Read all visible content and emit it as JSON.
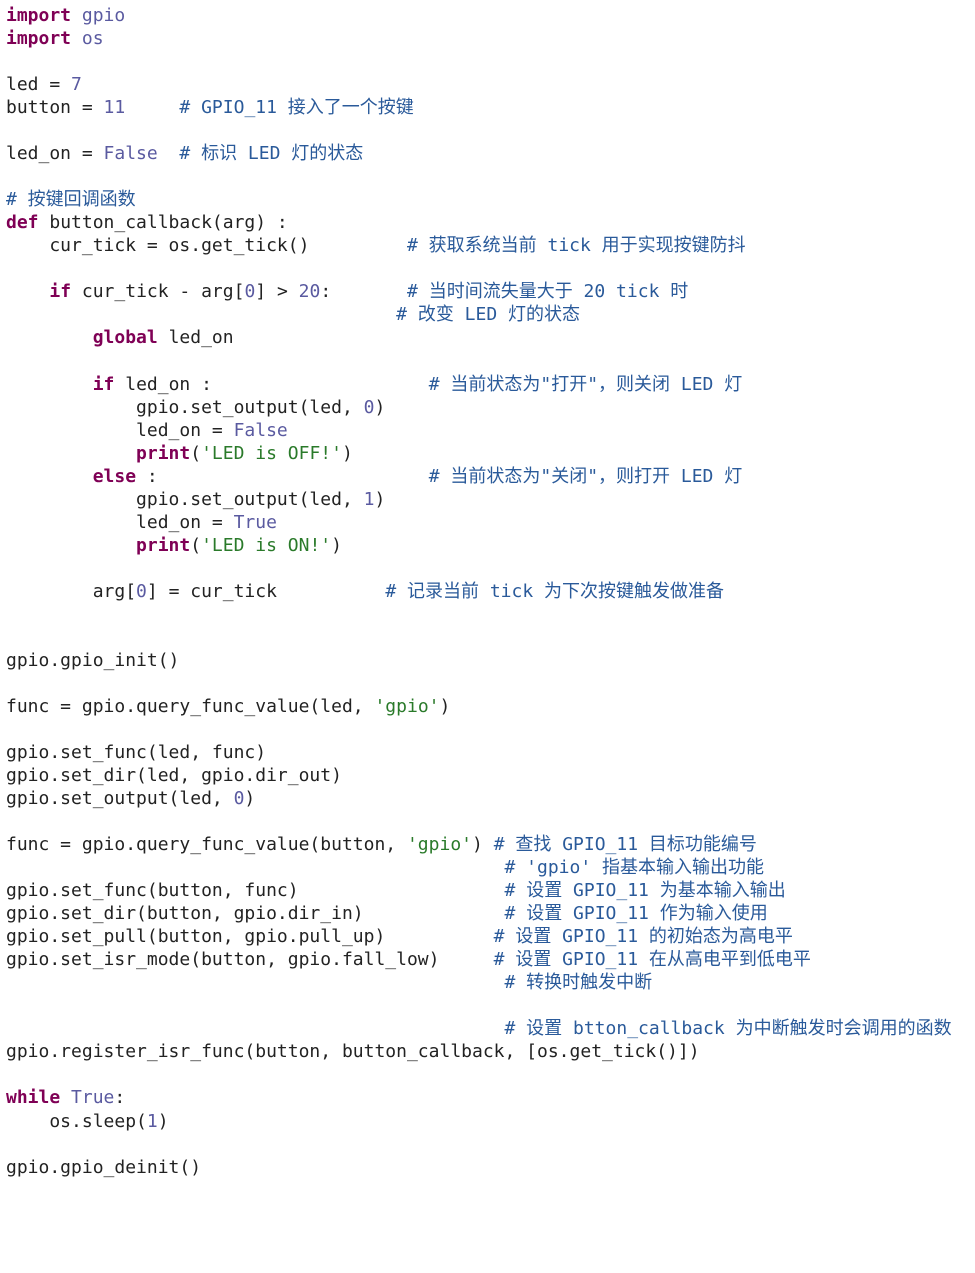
{
  "lines": {
    "l1_kw1": "import",
    "l1_mod": "gpio",
    "l2_kw1": "import",
    "l2_mod": "os",
    "l4_a": "led = ",
    "l4_num": "7",
    "l5_a": "button = ",
    "l5_num": "11",
    "l5_cmt": "# GPIO_11 接入了一个按键",
    "l7_a": "led_on = ",
    "l7_bool": "False",
    "l7_cmt": "# 标识 LED 灯的状态",
    "l9_cmt": "# 按键回调函数",
    "l10_def": "def",
    "l10_name": " button_callback(arg) :",
    "l11_a": "    cur_tick = os.get_tick()",
    "l11_cmt": "# 获取系统当前 tick 用于实现按键防抖",
    "l13_if": "if",
    "l13_body": " cur_tick - arg[",
    "l13_num0": "0",
    "l13_body2": "] > ",
    "l13_num20": "20",
    "l13_body3": ":",
    "l13_cmt": "# 当时间流失量大于 20 tick 时",
    "l14_cmt": "# 改变 LED 灯的状态",
    "l15_global": "global",
    "l15_rest": " led_on",
    "l17_if": "if",
    "l17_rest": " led_on :",
    "l17_cmt": "# 当前状态为\"打开\"，则关闭 LED 灯",
    "l18_a": "            gpio.set_output(led, ",
    "l18_num": "0",
    "l18_b": ")",
    "l19_a": "            led_on = ",
    "l19_bool": "False",
    "l20_print": "print",
    "l20_p1": "(",
    "l20_str": "'LED is OFF!'",
    "l20_p2": ")",
    "l21_else": "else",
    "l21_rest": " :",
    "l21_cmt": "# 当前状态为\"关闭\"，则打开 LED 灯",
    "l22_a": "            gpio.set_output(led, ",
    "l22_num": "1",
    "l22_b": ")",
    "l23_a": "            led_on = ",
    "l23_bool": "True",
    "l24_print": "print",
    "l24_p1": "(",
    "l24_str": "'LED is ON!'",
    "l24_p2": ")",
    "l26_a": "        arg[",
    "l26_num": "0",
    "l26_b": "] = cur_tick",
    "l26_cmt": "# 记录当前 tick 为下次按键触发做准备",
    "l29": "gpio.gpio_init()",
    "l31_a": "func = gpio.query_func_value(led, ",
    "l31_str": "'gpio'",
    "l31_b": ")",
    "l33": "gpio.set_func(led, func)",
    "l34": "gpio.set_dir(led, gpio.dir_out)",
    "l35_a": "gpio.set_output(led, ",
    "l35_num": "0",
    "l35_b": ")",
    "l37_a": "func = gpio.query_func_value(button, ",
    "l37_str": "'gpio'",
    "l37_b": ")",
    "l37_cmt": "# 查找 GPIO_11 目标功能编号",
    "l38_cmt": "# 'gpio' 指基本输入输出功能",
    "l39_a": "gpio.set_func(button, func)",
    "l39_cmt": "# 设置 GPIO_11 为基本输入输出",
    "l40_a": "gpio.set_dir(button, gpio.dir_in)",
    "l40_cmt": "# 设置 GPIO_11 作为输入使用",
    "l41_a": "gpio.set_pull(button, gpio.pull_up)",
    "l41_cmt": "# 设置 GPIO_11 的初始态为高电平",
    "l42_a": "gpio.set_isr_mode(button, gpio.fall_low)",
    "l42_cmt": "# 设置 GPIO_11 在从高电平到低电平",
    "l43_cmt": "# 转换时触发中断",
    "l45_cmt": "# 设置 btton_callback 为中断触发时会调用的函数",
    "l46": "gpio.register_isr_func(button, button_callback, [os.get_tick()])",
    "l48_while": "while",
    "l48_sp": " ",
    "l48_bool": "True",
    "l48_colon": ":",
    "l49_a": "    os.sleep(",
    "l49_num": "1",
    "l49_b": ")",
    "l51": "gpio.gpio_deinit()"
  },
  "spacing": {
    "col_cmt_mid": "         ",
    "indent4": "    ",
    "indent8": "        ",
    "indent12": "            "
  }
}
